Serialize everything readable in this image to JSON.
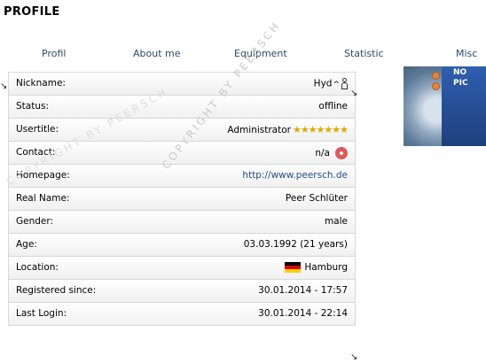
{
  "page": {
    "title": "PROFILE"
  },
  "tabs": [
    "Profil",
    "About me",
    "Equipment",
    "Statistic",
    "Misc"
  ],
  "profile": {
    "labels": {
      "nickname": "Nickname:",
      "status": "Status:",
      "usertitle": "Usertitle:",
      "contact": "Contact:",
      "homepage": "Homepage:",
      "realname": "Real Name:",
      "gender": "Gender:",
      "age": "Age:",
      "location": "Location:",
      "registered": "Registered since:",
      "lastlogin": "Last Login:"
    },
    "values": {
      "nickname": "Hyd",
      "status": "offline",
      "usertitle": "Administrator",
      "contact": "n/a",
      "homepage": "http://www.peersch.de",
      "realname": "Peer Schlüter",
      "gender": "male",
      "age": "03.03.1992 (21 years)",
      "location": "Hamburg",
      "registered": "30.01.2014 - 17:57",
      "lastlogin": "30.01.2014 - 22:14"
    },
    "usertitle_stars": "★★★★★★★",
    "icons": {
      "nickname_icon": "person-icon",
      "contact_icon": "flower-icon",
      "location_flag": "germany-flag-icon"
    }
  },
  "avatar": {
    "line1": "NO",
    "line2": "PIC",
    "colors": {
      "band": "#2f5fb0",
      "dot": "#e8823a"
    }
  },
  "watermarks": {
    "diag": "COPYRIGHT BY PEERSCH",
    "left": "COPYRIGHT BY PEERSCH"
  }
}
